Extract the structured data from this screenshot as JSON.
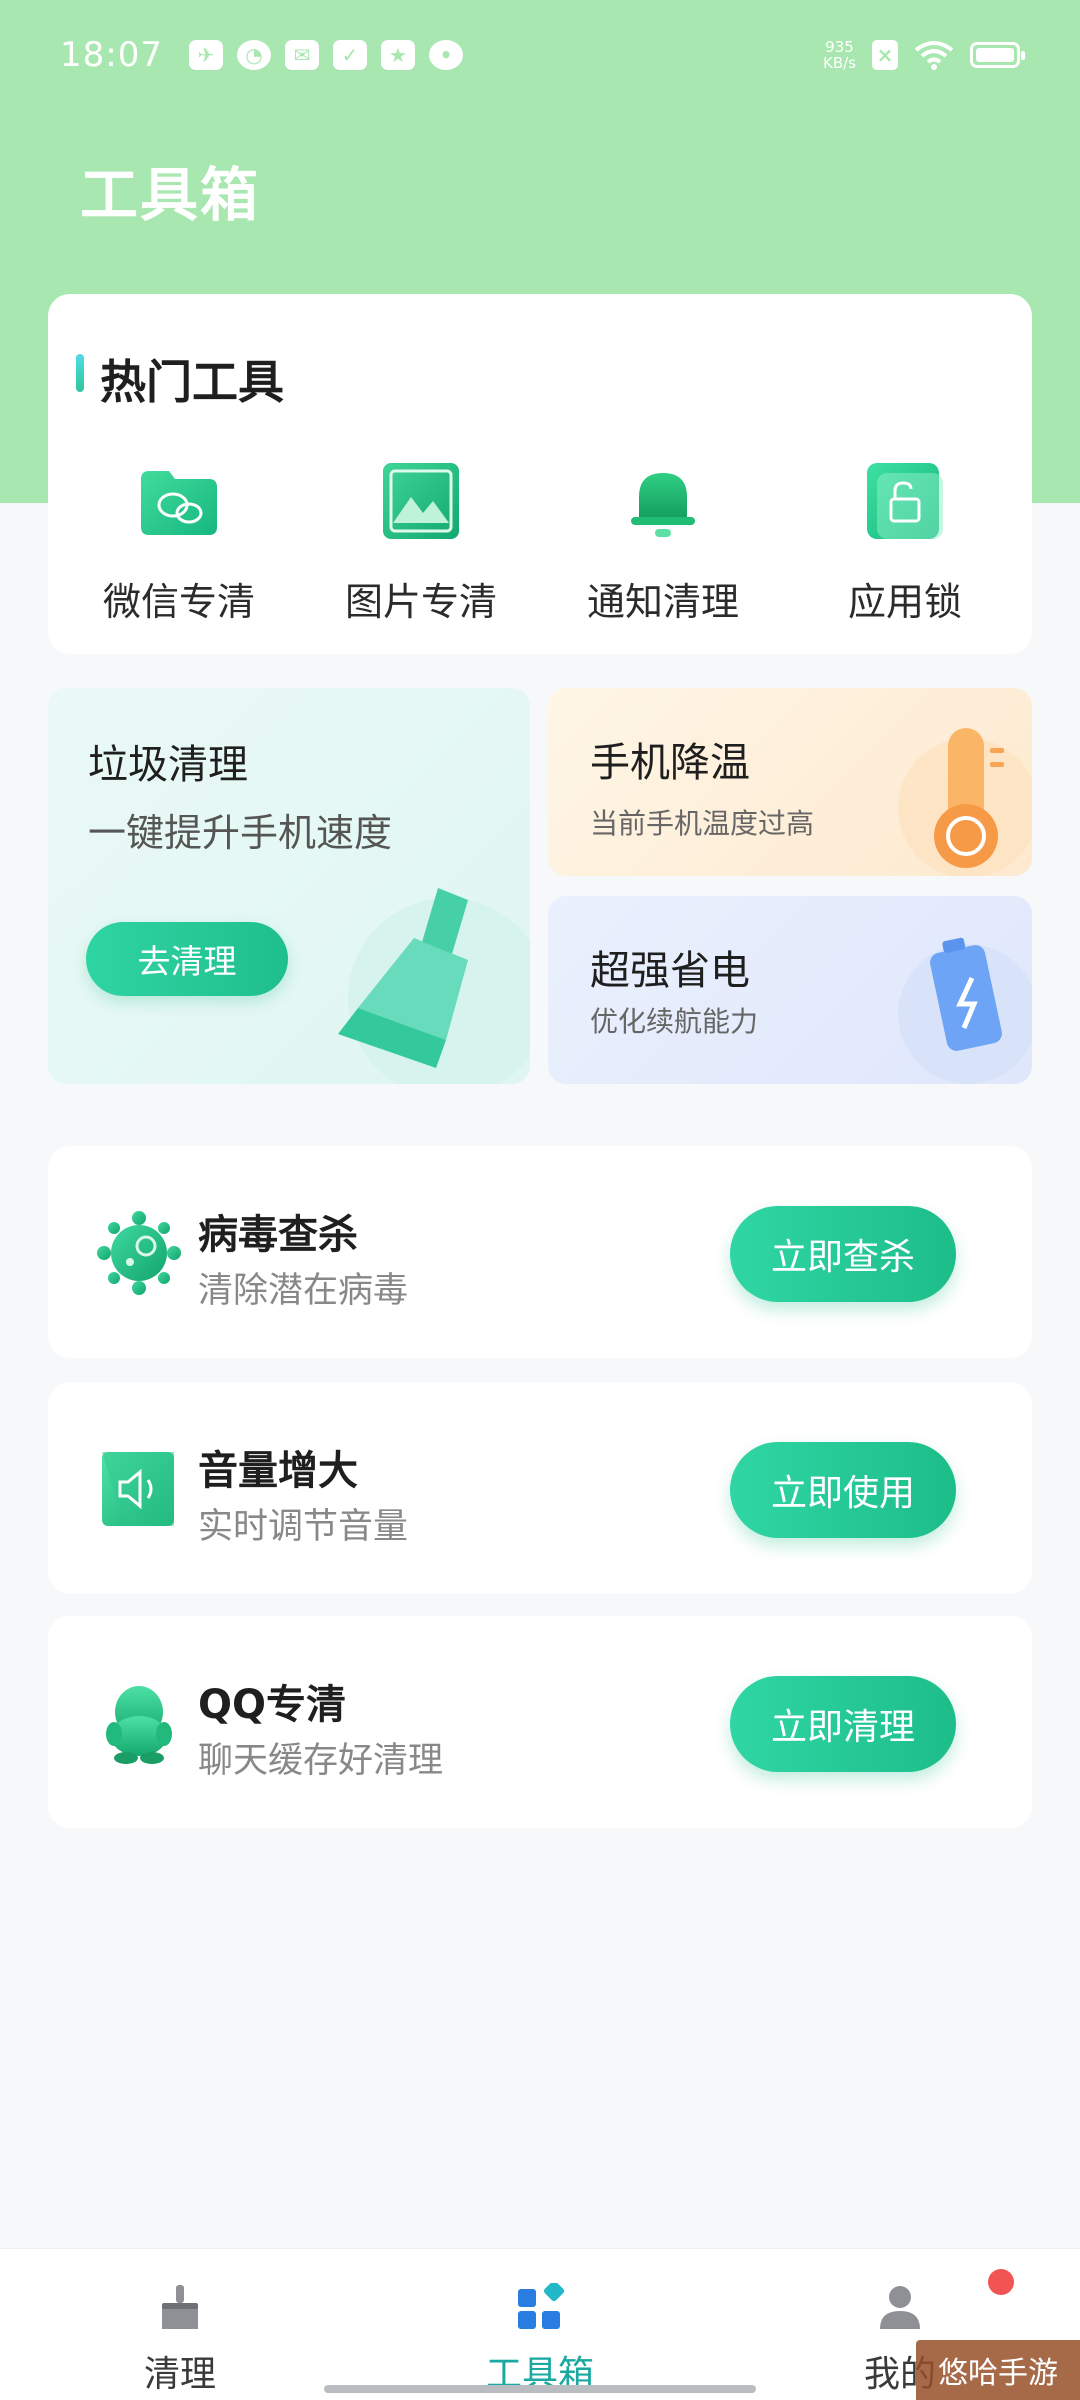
{
  "status_bar": {
    "time": "18:07",
    "netspeed_value": "935",
    "netspeed_unit": "KB/s"
  },
  "page_title": "工具箱",
  "hot_tools": {
    "title": "热门工具",
    "items": [
      {
        "label": "微信专清",
        "icon": "wechat-folder-icon"
      },
      {
        "label": "图片专清",
        "icon": "image-icon"
      },
      {
        "label": "通知清理",
        "icon": "bell-icon"
      },
      {
        "label": "应用锁",
        "icon": "lock-icon"
      }
    ]
  },
  "features": {
    "junk": {
      "title": "垃圾清理",
      "subtitle": "一键提升手机速度",
      "button": "去清理"
    },
    "cool": {
      "title": "手机降温",
      "subtitle": "当前手机温度过高"
    },
    "power": {
      "title": "超强省电",
      "subtitle": "优化续航能力"
    }
  },
  "list": [
    {
      "title": "病毒查杀",
      "subtitle": "清除潜在病毒",
      "button": "立即查杀",
      "icon": "virus-icon"
    },
    {
      "title": "音量增大",
      "subtitle": "实时调节音量",
      "button": "立即使用",
      "icon": "speaker-icon"
    },
    {
      "title": "QQ专清",
      "subtitle": "聊天缓存好清理",
      "button": "立即清理",
      "icon": "qq-penguin-icon"
    }
  ],
  "bottom_nav": [
    {
      "label": "清理",
      "icon": "broom-icon"
    },
    {
      "label": "工具箱",
      "icon": "toolbox-grid-icon"
    },
    {
      "label": "我的",
      "icon": "profile-icon"
    }
  ],
  "watermark": "悠哈手游",
  "colors": {
    "header_bg": "#a8e8b0",
    "accent_green": "#1fbf8b",
    "active_tab": "#1aa8a0"
  }
}
